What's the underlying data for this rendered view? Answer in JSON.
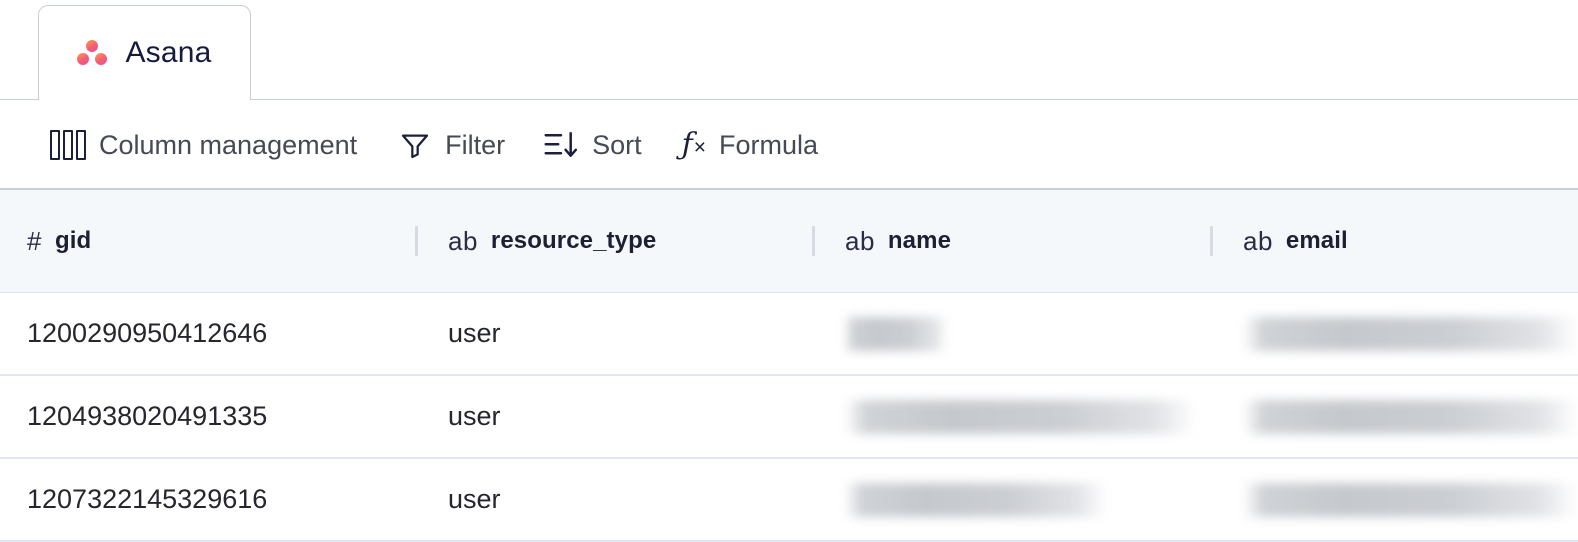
{
  "tab": {
    "label": "Asana",
    "logo_icon": "asana-logo-icon",
    "logo_color": "#f45b7a"
  },
  "toolbar": {
    "items": [
      {
        "label": "Column management",
        "icon": "columns-icon"
      },
      {
        "label": "Filter",
        "icon": "filter-icon"
      },
      {
        "label": "Sort",
        "icon": "sort-descending-icon"
      },
      {
        "label": "Formula",
        "icon": "fx-formula-icon"
      }
    ]
  },
  "table": {
    "columns": [
      {
        "name": "gid",
        "type_glyph": "#",
        "type_icon": "number-type-icon"
      },
      {
        "name": "resource_type",
        "type_glyph": "ab",
        "type_icon": "text-type-icon"
      },
      {
        "name": "name",
        "type_glyph": "ab",
        "type_icon": "text-type-icon"
      },
      {
        "name": "email",
        "type_glyph": "ab",
        "type_icon": "text-type-icon"
      }
    ],
    "rows": [
      {
        "gid": "1200290950412646",
        "resource_type": "user",
        "name": "",
        "email": "",
        "name_redacted": true,
        "email_redacted": true,
        "name_width": 102,
        "email_width": 368
      },
      {
        "gid": "1204938020491335",
        "resource_type": "user",
        "name": "",
        "email": "",
        "name_redacted": true,
        "email_redacted": true,
        "name_width": 351,
        "email_width": 368
      },
      {
        "gid": "1207322145329616",
        "resource_type": "user",
        "name": "",
        "email": "",
        "name_redacted": true,
        "email_redacted": true,
        "name_width": 262,
        "email_width": 368
      }
    ]
  },
  "colors": {
    "header_bg": "#f4f8fa",
    "row_divider": "#e2e6f2",
    "border": "#c6cfd6",
    "text": "#25262e"
  }
}
